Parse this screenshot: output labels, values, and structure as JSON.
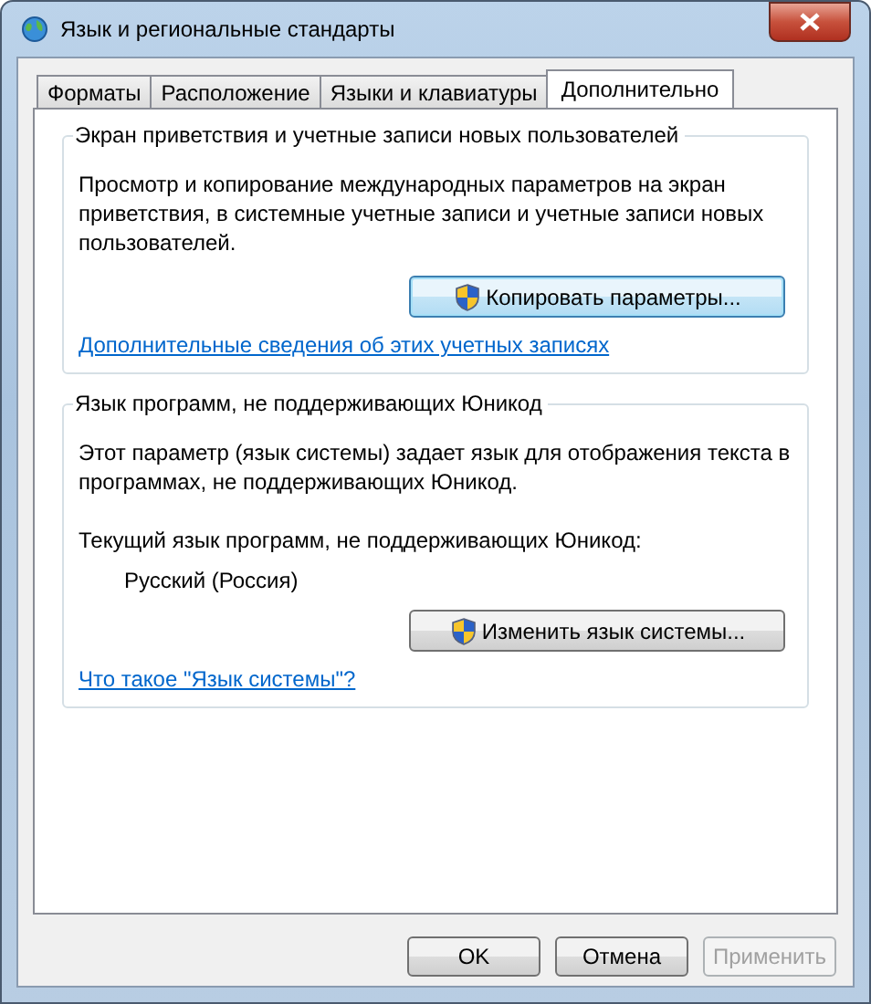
{
  "window": {
    "title": "Язык и региональные стандарты"
  },
  "tabs": [
    {
      "label": "Форматы",
      "selected": false
    },
    {
      "label": "Расположение",
      "selected": false
    },
    {
      "label": "Языки и клавиатуры",
      "selected": false
    },
    {
      "label": "Дополнительно",
      "selected": true
    }
  ],
  "groups": [
    {
      "title": "Экран приветствия и учетные записи новых пользователей",
      "items": [
        {
          "kind": "text",
          "text": "Просмотр и копирование международных параметров на экран приветствия, в системные учетные записи и учетные записи новых пользователей."
        },
        {
          "kind": "button",
          "label": "Копировать параметры...",
          "focused": true
        },
        {
          "kind": "link",
          "text": "Дополнительные сведения об этих учетных записях"
        }
      ]
    },
    {
      "title": "Язык программ, не поддерживающих Юникод",
      "items": [
        {
          "kind": "text",
          "text": "Этот параметр (язык системы) задает язык для отображения текста в программах, не поддерживающих Юникод."
        },
        {
          "kind": "text",
          "text": "Текущий язык программ, не поддерживающих Юникод:"
        },
        {
          "kind": "value",
          "text": "Русский (Россия)"
        },
        {
          "kind": "button",
          "label": "Изменить язык системы...",
          "focused": false
        },
        {
          "kind": "link",
          "text": "Что такое \"Язык системы\"?"
        }
      ]
    }
  ],
  "buttons": [
    {
      "label": "OK",
      "disabled": false
    },
    {
      "label": "Отмена",
      "disabled": false
    },
    {
      "label": "Применить",
      "disabled": true
    }
  ]
}
